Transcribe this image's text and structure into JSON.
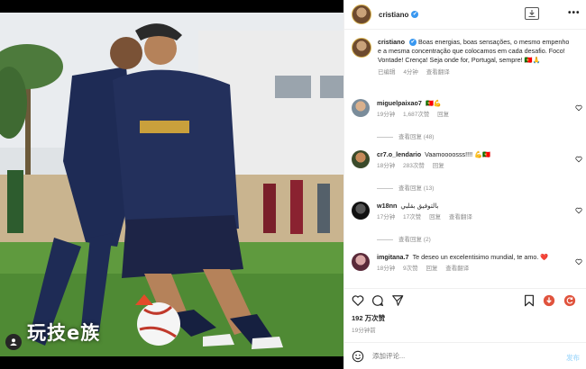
{
  "post": {
    "watermark": "玩技e族",
    "image_alt_icon": "user-tag-icon"
  },
  "header": {
    "username": "cristiano",
    "verified": "✔",
    "more": "•••"
  },
  "caption": {
    "username": "cristiano",
    "text": "Boas energias, boas sensações, o mesmo empenho e a mesma concentração que colocamos em cada desafio. Foco! Vontade! Crença! Seja onde for, Portugal, sempre! 🇵🇹🙏",
    "edited": "已编辑",
    "time": "4分钟",
    "translate": "查看翻译"
  },
  "comments": [
    {
      "username": "miguelpaixao7",
      "text": "🇵🇹💪",
      "time": "19分钟",
      "likes": "1,687次赞",
      "reply": "回复",
      "translate": "",
      "replies": "查看回复 (48)"
    },
    {
      "username": "cr7.o_lendario",
      "text": "Vaamoooosss!!!! 💪🇵🇹",
      "time": "18分钟",
      "likes": "283次赞",
      "reply": "回复",
      "translate": "",
      "replies": "查看回复 (13)"
    },
    {
      "username": "w18nn",
      "text": "بالتوفيق بقلبي",
      "time": "17分钟",
      "likes": "17次赞",
      "reply": "回复",
      "translate": "查看翻译",
      "replies": "查看回复 (2)"
    },
    {
      "username": "imgitana.7",
      "text": "Te deseo un excelentisimo mundial, te amo. ❤️",
      "time": "18分钟",
      "likes": "9次赞",
      "reply": "回复",
      "translate": "查看翻译",
      "replies": ""
    }
  ],
  "footer": {
    "likes": "192 万次赞",
    "time": "19分钟前",
    "comment_placeholder": "添加评论...",
    "post_label": "发布"
  },
  "colors": {
    "verified": "#3897f0",
    "extension_red": "#e0533d"
  }
}
